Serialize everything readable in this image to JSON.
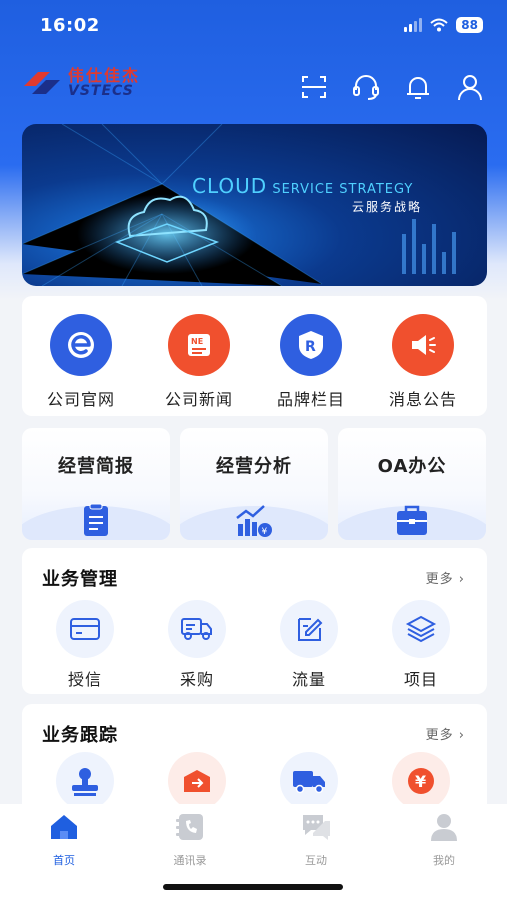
{
  "status": {
    "time": "16:02",
    "battery": "88"
  },
  "header": {
    "logo_cn": "伟仕佳杰",
    "logo_en": "VSTECS",
    "icons": [
      "scan-icon",
      "headset-icon",
      "bell-icon",
      "user-icon"
    ]
  },
  "banner": {
    "title_big": "CLOUD",
    "title_rest": " SERVICE STRATEGY",
    "subtitle": "云服务战略"
  },
  "quick_links": [
    {
      "label": "公司官网",
      "icon": "website-icon",
      "color": "#2f5fe0"
    },
    {
      "label": "公司新闻",
      "icon": "news-icon",
      "color": "#f0502e"
    },
    {
      "label": "品牌栏目",
      "icon": "brand-icon",
      "color": "#2f5fe0"
    },
    {
      "label": "消息公告",
      "icon": "announcement-icon",
      "color": "#f0502e"
    }
  ],
  "tiles": [
    {
      "title": "经营简报",
      "icon": "clipboard-icon"
    },
    {
      "title": "经营分析",
      "icon": "analysis-chart-icon"
    },
    {
      "title": "OA办公",
      "icon": "briefcase-icon"
    }
  ],
  "business_management": {
    "title": "业务管理",
    "more": "更多",
    "items": [
      {
        "label": "授信",
        "icon": "credit-card-icon"
      },
      {
        "label": "采购",
        "icon": "truck-icon"
      },
      {
        "label": "流量",
        "icon": "edit-icon"
      },
      {
        "label": "项目",
        "icon": "layers-icon"
      }
    ]
  },
  "business_tracking": {
    "title": "业务跟踪",
    "more": "更多",
    "items": [
      {
        "icon": "stamp-icon"
      },
      {
        "icon": "dispatch-icon"
      },
      {
        "icon": "delivery-truck-icon"
      },
      {
        "icon": "yuan-icon"
      }
    ]
  },
  "tabbar": {
    "active": "首页",
    "tabs": [
      {
        "label": "首页",
        "icon": "home-icon"
      },
      {
        "label": "通讯录",
        "icon": "contacts-icon"
      },
      {
        "label": "互动",
        "icon": "chat-icon"
      },
      {
        "label": "我的",
        "icon": "profile-icon"
      }
    ]
  },
  "colors": {
    "primary": "#1f5fe0",
    "accent": "#f0502e"
  }
}
